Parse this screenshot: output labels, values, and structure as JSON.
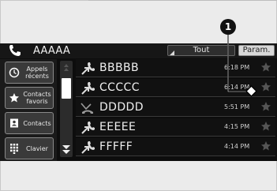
{
  "header": {
    "contact_name": "AAAAA",
    "tout_label": "Tout",
    "param_label": "Param."
  },
  "sidebar": {
    "items": [
      {
        "label": "Appels récents",
        "icon": "clock-icon"
      },
      {
        "label": "Contacts favoris",
        "icon": "star-icon"
      },
      {
        "label": "Contacts",
        "icon": "contacts-book-icon"
      },
      {
        "label": "Clavier",
        "icon": "keypad-icon"
      }
    ]
  },
  "calls": [
    {
      "name": "BBBBB",
      "time": "6:18 PM",
      "type": "outgoing"
    },
    {
      "name": "CCCCC",
      "time": "6:14 PM",
      "type": "outgoing"
    },
    {
      "name": "DDDDD",
      "time": "5:51 PM",
      "type": "missed"
    },
    {
      "name": "EEEEE",
      "time": "4:15 PM",
      "type": "outgoing"
    },
    {
      "name": "FFFFF",
      "time": "4:14 PM",
      "type": "outgoing"
    }
  ],
  "callout": {
    "number": "1"
  },
  "colors": {
    "screen_bg": "#0d0d0d",
    "icon": "#dcdcdc",
    "star": "#555555"
  }
}
